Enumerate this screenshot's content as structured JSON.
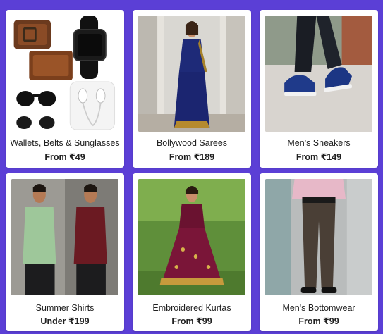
{
  "products": [
    {
      "title": "Wallets, Belts & Sunglasses",
      "price": "From ₹49",
      "image": "accessories-image"
    },
    {
      "title": "Bollywood Sarees",
      "price": "From ₹189",
      "image": "saree-image"
    },
    {
      "title": "Men's Sneakers",
      "price": "From ₹149",
      "image": "sneakers-image"
    },
    {
      "title": "Summer Shirts",
      "price": "Under ₹199",
      "image": "shirts-image"
    },
    {
      "title": "Embroidered Kurtas",
      "price": "From ₹99",
      "image": "kurta-image"
    },
    {
      "title": "Men's Bottomwear",
      "price": "From ₹99",
      "image": "trousers-image"
    }
  ],
  "colors": {
    "background": "#5b3fd6",
    "card": "#ffffff",
    "text": "#212121"
  }
}
